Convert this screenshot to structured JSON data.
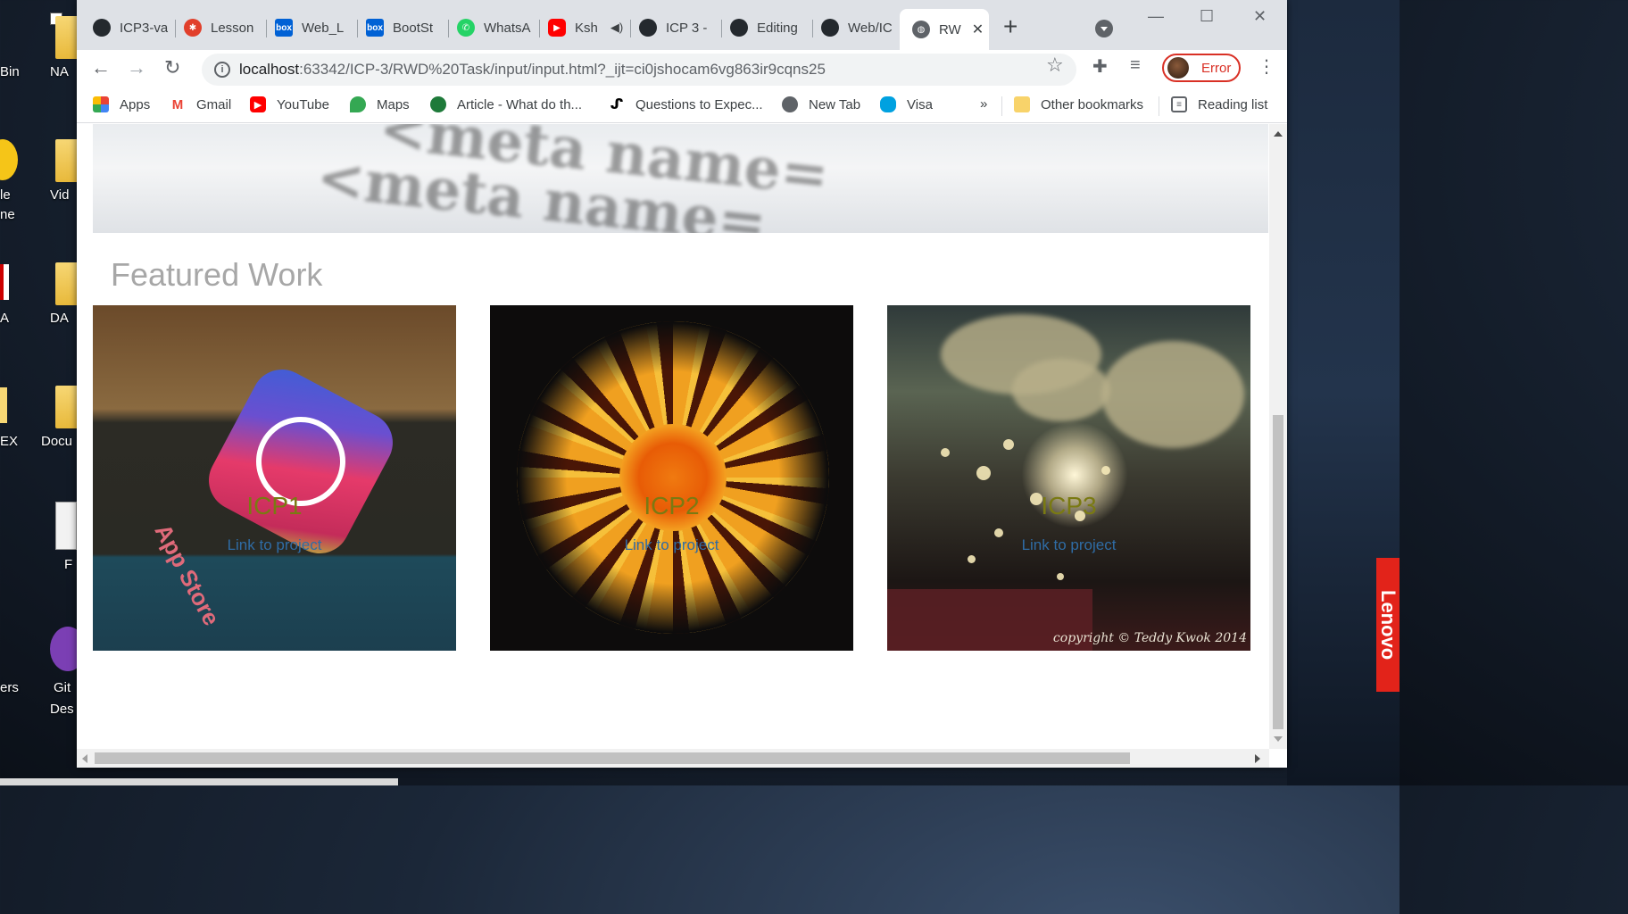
{
  "desktop": {
    "icons": [
      {
        "left_label": "Bin",
        "right_label": "NA"
      },
      {
        "left_label": "le",
        "right_label": "Vid"
      },
      {
        "left_label": "A",
        "right_label": "DA"
      },
      {
        "left_label": "EX",
        "right_label": "Docu"
      },
      {
        "left_label": "",
        "right_label": "F"
      },
      {
        "left_label": "ers",
        "right_label": "Git"
      }
    ],
    "extra_labels": [
      "ne",
      "Des"
    ],
    "brand": "Lenovo"
  },
  "browser": {
    "tabs": [
      {
        "label": "ICP3-va",
        "icon": "github-icon"
      },
      {
        "label": "Lesson",
        "icon": "canvas-icon"
      },
      {
        "label": "Web_L",
        "icon": "box-icon"
      },
      {
        "label": "BootSt",
        "icon": "box-icon"
      },
      {
        "label": "WhatsA",
        "icon": "whatsapp-icon"
      },
      {
        "label": "Ksh",
        "icon": "youtube-icon"
      },
      {
        "label": "ICP 3 -",
        "icon": "github-icon"
      },
      {
        "label": "Editing",
        "icon": "github-icon"
      },
      {
        "label": "Web/IC",
        "icon": "github-icon"
      },
      {
        "label": "RW",
        "icon": "globe-icon"
      }
    ],
    "address": {
      "host": "localhost",
      "rest": ":63342/ICP-3/RWD%20Task/input/input.html?_ijt=ci0jshocam6vg863ir9cqns25"
    },
    "profile_label": "Error",
    "bookmarks": [
      {
        "label": "Apps",
        "icon": "apps-icon"
      },
      {
        "label": "Gmail",
        "icon": "gmail-icon"
      },
      {
        "label": "YouTube",
        "icon": "youtube-icon"
      },
      {
        "label": "Maps",
        "icon": "maps-icon"
      },
      {
        "label": "Article - What do th...",
        "icon": "article-icon"
      },
      {
        "label": "Questions to Expec...",
        "icon": "questions-icon"
      },
      {
        "label": "New Tab",
        "icon": "globe-icon"
      },
      {
        "label": "Visa",
        "icon": "salesforce-icon"
      }
    ],
    "bookmarks_overflow": "»",
    "other_bookmarks": "Other bookmarks",
    "reading_list": "Reading list"
  },
  "page": {
    "hero_lines": [
      "<meta  name=",
      "<meta  name="
    ],
    "featured_title": "Featured Work",
    "cards": [
      {
        "title": "ICP1",
        "link": "Link to project",
        "image_text": "App Store"
      },
      {
        "title": "ICP2",
        "link": "Link to project"
      },
      {
        "title": "ICP3",
        "link": "Link to project",
        "image_text": "copyright © Teddy Kwok 2014"
      }
    ]
  },
  "colors": {
    "card_title": "#7a7a12",
    "card_link": "#2f6ca5",
    "featured_title": "#a7a7a7",
    "profile_error": "#d93025"
  }
}
